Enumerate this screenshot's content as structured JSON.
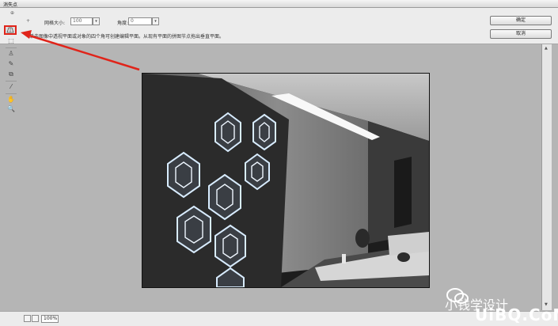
{
  "window": {
    "title": "消失点"
  },
  "options": {
    "grid_size_label": "网格大小:",
    "grid_size_value": "100",
    "angle_label": "角度:",
    "angle_value": "0",
    "hint": "单击图像中透视平面或对象的四个角可创建编辑平面。从现有平面的拼图节点拖出垂直平面。"
  },
  "buttons": {
    "ok": "确定",
    "cancel": "取消"
  },
  "status": {
    "zoom": "100%"
  },
  "watermark": {
    "line1": "小钱学设计",
    "line2": "UiBQ.CoM"
  },
  "colors": {
    "annotation_red": "#e0241a",
    "hex_glow": "#cfe6ff"
  }
}
